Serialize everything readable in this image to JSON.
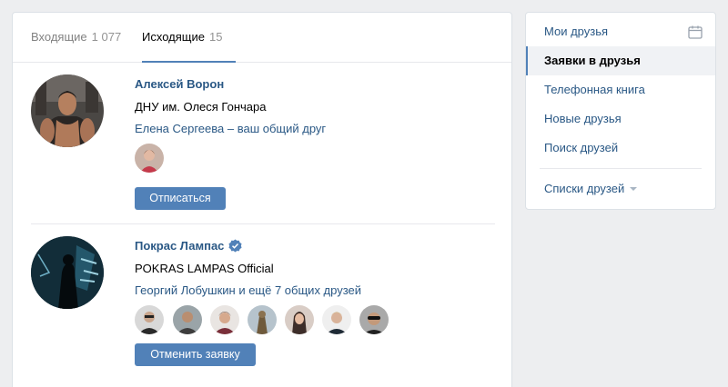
{
  "tabs": [
    {
      "label": "Входящие",
      "count": "1 077",
      "active": false
    },
    {
      "label": "Исходящие",
      "count": "15",
      "active": true
    }
  ],
  "requests": [
    {
      "name": "Алексей Ворон",
      "verified": false,
      "subtitle": "ДНУ им. Олеся Гончара",
      "mutual_text": "Елена Сергеева – ваш общий друг",
      "button_label": "Отписаться",
      "mutual_count": 1
    },
    {
      "name": "Покрас Лампас",
      "verified": true,
      "subtitle": "POKRAS LAMPAS Official",
      "mutual_text": "Георгий Лобушкин и ещё 7 общих друзей",
      "button_label": "Отменить заявку",
      "mutual_count": 7
    }
  ],
  "sidebar": {
    "items": [
      {
        "label": "Мои друзья",
        "active": false,
        "icon": "calendar-icon"
      },
      {
        "label": "Заявки в друзья",
        "active": true
      },
      {
        "label": "Телефонная книга",
        "active": false
      },
      {
        "label": "Новые друзья",
        "active": false
      },
      {
        "label": "Поиск друзей",
        "active": false
      }
    ],
    "lists_label": "Списки друзей"
  },
  "colors": {
    "accent": "#5181b8",
    "link": "#2a5885",
    "background": "#edeef0"
  }
}
